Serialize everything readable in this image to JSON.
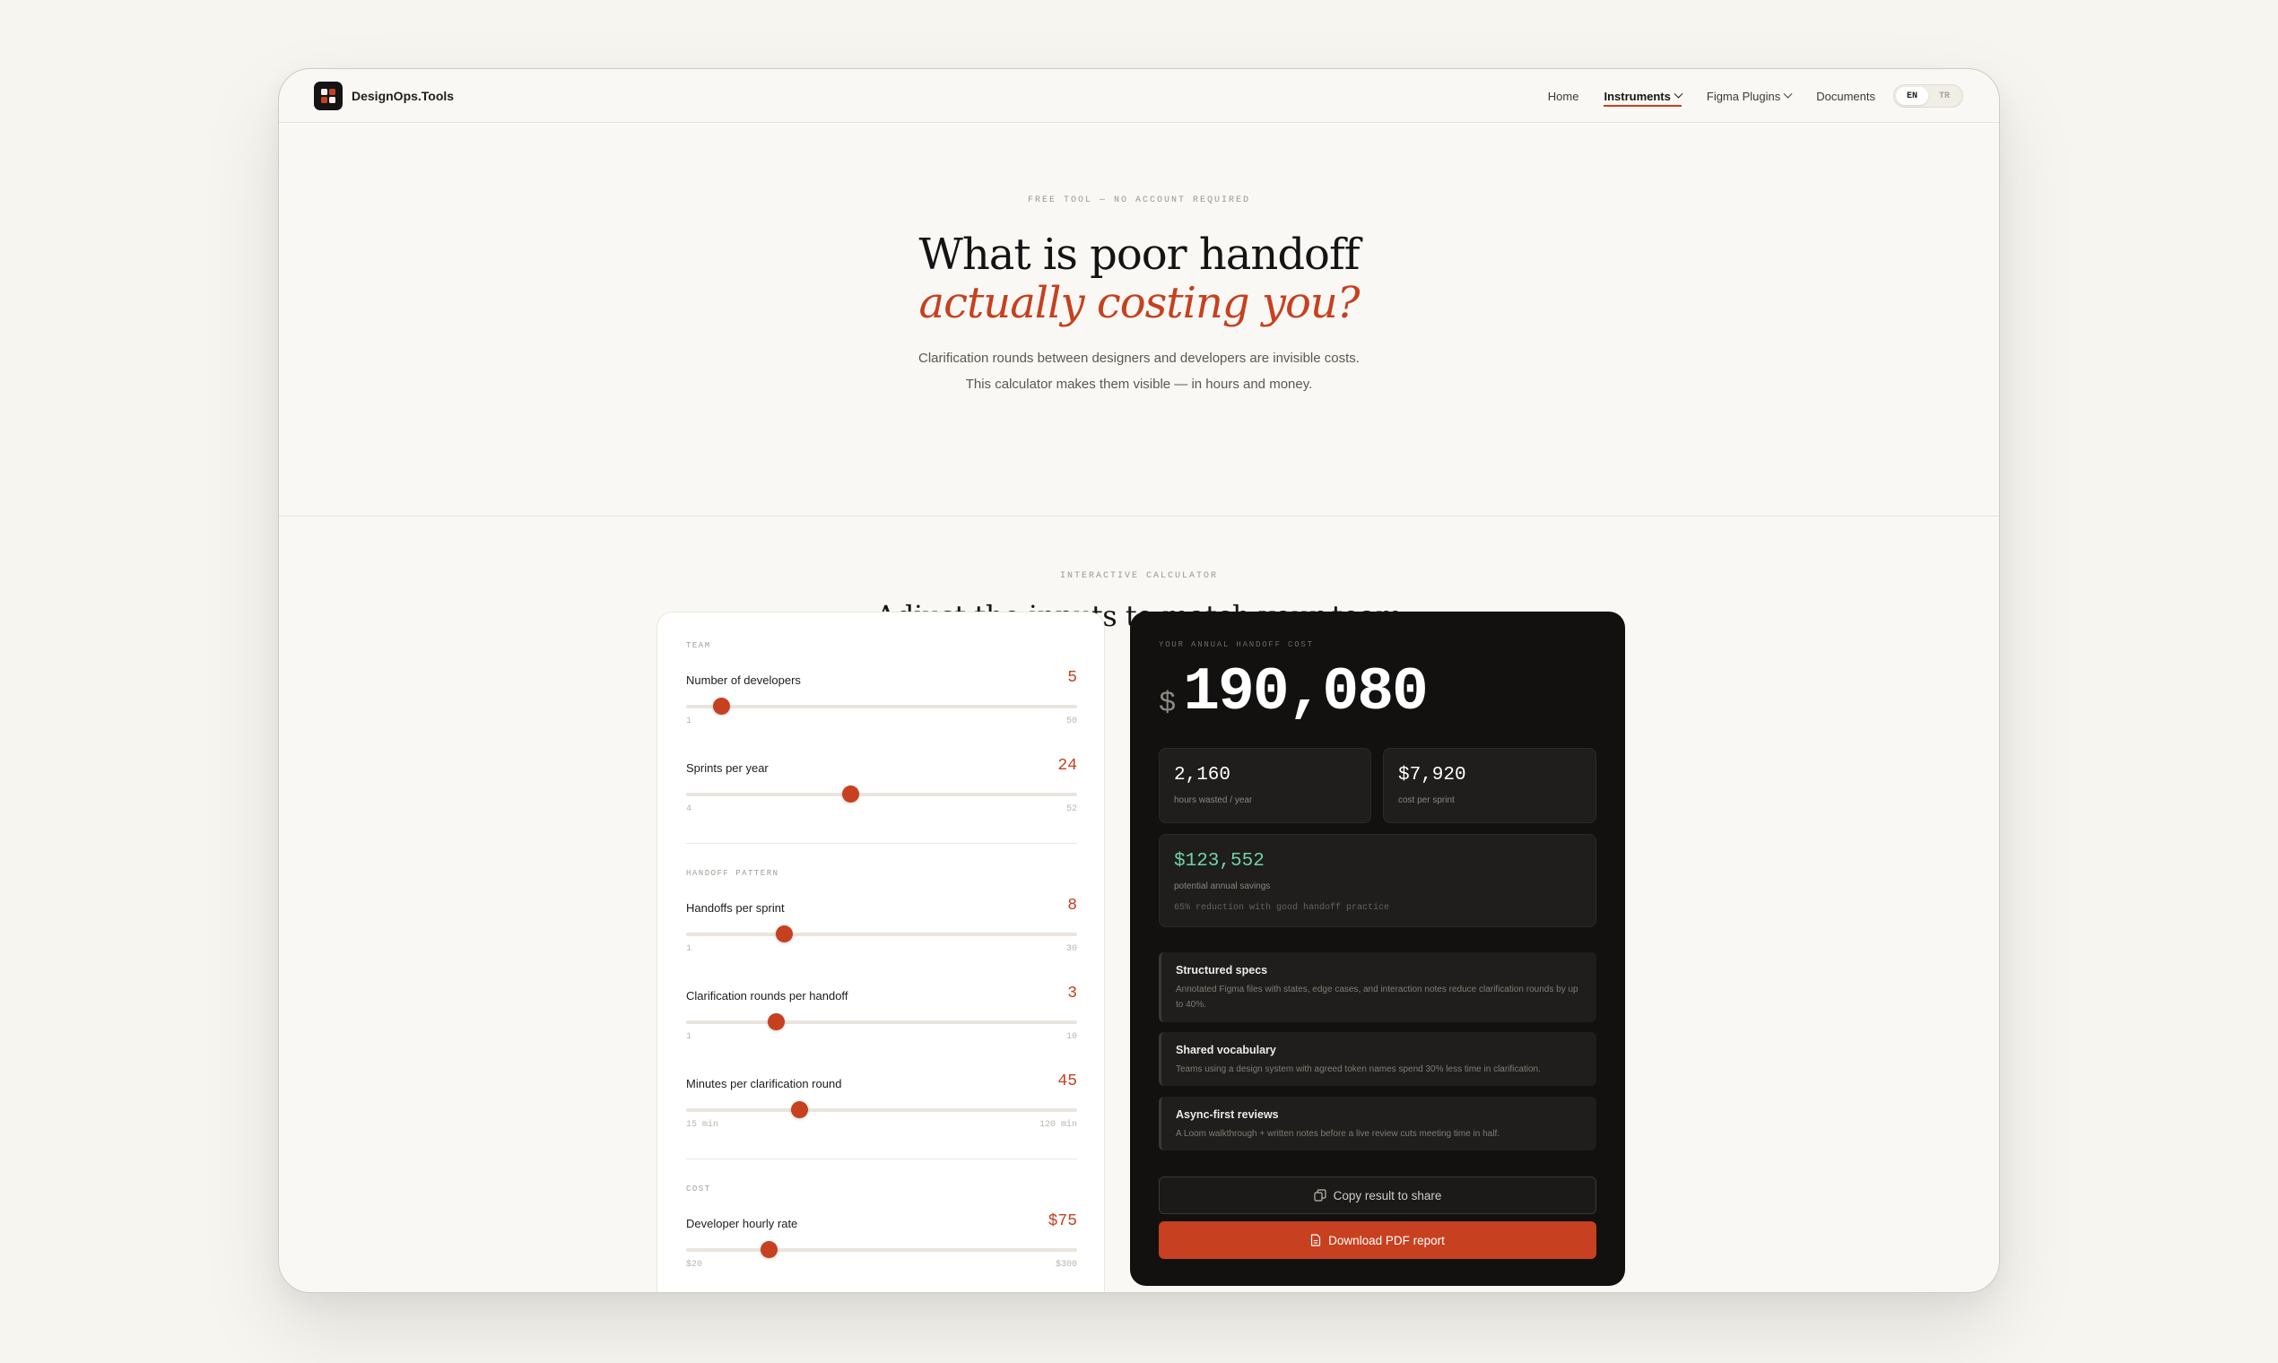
{
  "brand": {
    "name": "DesignOps.Tools"
  },
  "nav": {
    "items": [
      {
        "label": "Home"
      },
      {
        "label": "Instruments"
      },
      {
        "label": "Figma Plugins"
      },
      {
        "label": "Documents"
      }
    ],
    "lang": {
      "en": "EN",
      "tr": "TR",
      "selected": "EN"
    }
  },
  "hero": {
    "eyebrow": "FREE TOOL — NO ACCOUNT REQUIRED",
    "title_line1": "What is poor handoff",
    "title_line2": "actually costing you?",
    "desc_line1": "Clarification rounds between designers and developers are invisible costs.",
    "desc_line2": "This calculator makes them visible — in hours and money."
  },
  "calculator": {
    "eyebrow": "INTERACTIVE CALCULATOR",
    "title": "Adjust the inputs to match your team",
    "groups": {
      "team": "TEAM",
      "handoff": "HANDOFF PATTERN",
      "cost": "COST"
    },
    "inputs": [
      {
        "label": "Number of developers",
        "value": "5",
        "min_label": "1",
        "max_label": "50",
        "level": 0.09
      },
      {
        "label": "Sprints per year",
        "value": "24",
        "min_label": "4",
        "max_label": "52",
        "level": 0.42
      },
      {
        "label": "Handoffs per sprint",
        "value": "8",
        "min_label": "1",
        "max_label": "30",
        "level": 0.25
      },
      {
        "label": "Clarification rounds per handoff",
        "value": "3",
        "min_label": "1",
        "max_label": "10",
        "level": 0.23
      },
      {
        "label": "Minutes per clarification round",
        "value": "45",
        "min_label": "15 min",
        "max_label": "120 min",
        "level": 0.29
      },
      {
        "label": "Developer hourly rate",
        "value": "$75",
        "min_label": "$20",
        "max_label": "$300",
        "level": 0.21
      }
    ]
  },
  "results": {
    "eyebrow": "YOUR ANNUAL HANDOFF COST",
    "currency": "$",
    "total": "190,080",
    "hours_value": "2,160",
    "hours_caption": "hours wasted / year",
    "sprint_value": "$7,920",
    "sprint_caption": "cost per sprint",
    "savings_value": "$123,552",
    "savings_caption": "potential annual savings",
    "savings_note": "65% reduction with good handoff practice",
    "tips": [
      {
        "title": "Structured specs",
        "desc": "Annotated Figma files with states, edge cases, and interaction notes reduce clarification rounds by up to 40%."
      },
      {
        "title": "Shared vocabulary",
        "desc": "Teams using a design system with agreed token names spend 30% less time in clarification."
      },
      {
        "title": "Async-first reviews",
        "desc": "A Loom walkthrough + written notes before a live review cuts meeting time in half."
      }
    ],
    "copy_button": "Copy result to share",
    "download_button": "Download PDF report"
  },
  "colors": {
    "accent": "#c7401f",
    "dark_panel": "#121110",
    "savings_green": "#6fd3a6",
    "page_bg": "#f7f5f0"
  },
  "icons": {
    "copy": "copy-icon",
    "download": "document-icon",
    "chevron": "chevron-down-icon"
  }
}
